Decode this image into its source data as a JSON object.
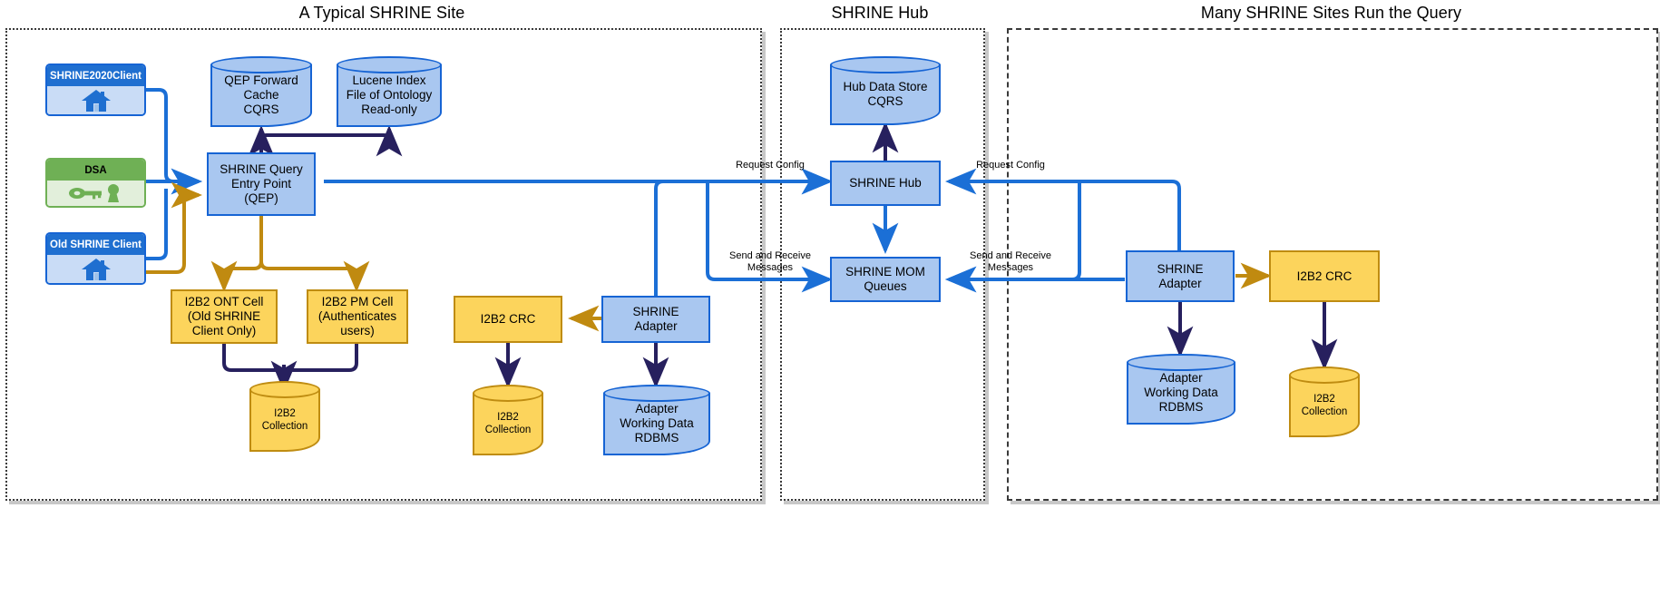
{
  "panels": [
    {
      "id": "site",
      "title": "A Typical SHRINE Site"
    },
    {
      "id": "hub",
      "title": "SHRINE Hub"
    },
    {
      "id": "many",
      "title": "Many SHRINE Sites Run the Query"
    }
  ],
  "site": {
    "clients": [
      {
        "name": "shrine2020client",
        "label": "SHRINE2020Client",
        "icon": "house-icon"
      },
      {
        "name": "dsa",
        "label": "DSA",
        "icon": "key-icon"
      },
      {
        "name": "old-shrine-client",
        "label": "Old SHRINE Client",
        "icon": "house-icon"
      }
    ],
    "qep_forward_cache": "QEP Forward\nCache\nCQRS",
    "lucene_index": "Lucene Index\nFile of Ontology\nRead-only",
    "qep": "SHRINE Query\nEntry Point\n(QEP)",
    "ont_cell": "I2B2 ONT Cell\n(Old SHRINE\nClient Only)",
    "pm_cell": "I2B2 PM Cell\n(Authenticates\nusers)",
    "i2b2_collection_cells": "I2B2\nCollection",
    "i2b2_crc": "I2B2 CRC",
    "i2b2_collection_crc": "I2B2\nCollection",
    "shrine_adapter": "SHRINE\nAdapter",
    "adapter_rdbms": "Adapter\nWorking Data\nRDBMS"
  },
  "hub": {
    "data_store": "Hub Data Store\nCQRS",
    "shrine_hub": "SHRINE Hub",
    "mom_queues": "SHRINE MOM\nQueues"
  },
  "many": {
    "shrine_adapter": "SHRINE\nAdapter",
    "i2b2_crc": "I2B2 CRC",
    "adapter_rdbms": "Adapter\nWorking Data\nRDBMS",
    "i2b2_collection": "I2B2\nCollection"
  },
  "edge_labels": {
    "request_config_left": "Request Config",
    "messages_left": "Send and Receive\nMessages",
    "request_config_right": "Request Config",
    "messages_right": "Send and Receive\nMessages"
  },
  "colors": {
    "blue_fill": "#a9c7f0",
    "blue_stroke": "#1664d4",
    "yellow_fill": "#fcd45c",
    "yellow_stroke": "#bf8c11",
    "green_header": "#6fb055",
    "green_fill": "#e2efdb",
    "client_header": "#1f6fd0",
    "client_fill": "#c9dcf6",
    "navy_arrow": "#27205e",
    "blue_arrow": "#1b6fd6",
    "gold_arrow": "#c08a10",
    "panel_border": "#3a3a3a",
    "panel_shadow": "#c8c8c8"
  }
}
